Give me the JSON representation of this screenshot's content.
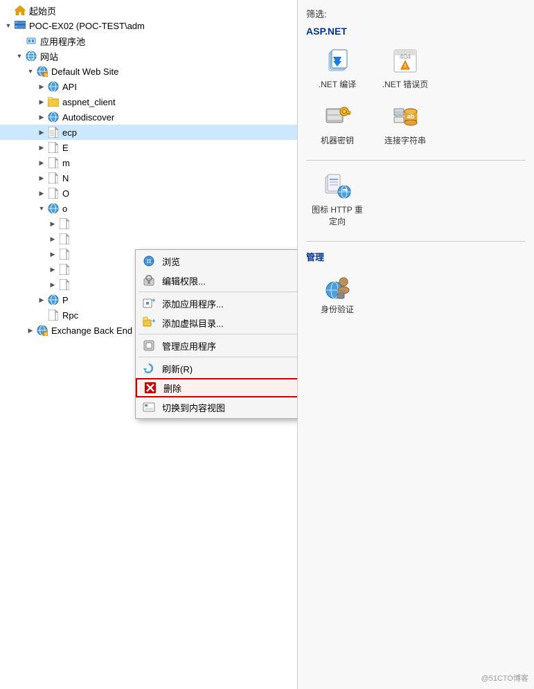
{
  "filter_label": "筛选:",
  "asp_net_section": "ASP.NET",
  "manage_section": "管理",
  "features": [
    {
      "id": "dotnet-compile",
      "label": ".NET 编译",
      "icon_type": "dotnet-compile"
    },
    {
      "id": "dotnet-error",
      "label": ".NET 错误页",
      "icon_type": "dotnet-error"
    },
    {
      "id": "machine-key",
      "label": "机器密钥",
      "icon_type": "machine-key"
    },
    {
      "id": "connection-string",
      "label": "连接字符串",
      "icon_type": "connection-string"
    },
    {
      "id": "mime-icon",
      "label": "图标 HTTP 重定向",
      "icon_type": "http-redirect"
    }
  ],
  "manage_features": [
    {
      "id": "auth",
      "label": "身份验证",
      "icon_type": "auth"
    }
  ],
  "tree": {
    "items": [
      {
        "id": "start-page",
        "label": "起始页",
        "indent": 0,
        "icon": "home",
        "expand": "none"
      },
      {
        "id": "server",
        "label": "POC-EX02 (POC-TEST\\adm",
        "indent": 0,
        "icon": "server",
        "expand": "down"
      },
      {
        "id": "app-pools",
        "label": "应用程序池",
        "indent": 1,
        "icon": "pool",
        "expand": "none"
      },
      {
        "id": "sites",
        "label": "网站",
        "indent": 1,
        "icon": "globe",
        "expand": "down"
      },
      {
        "id": "default-web-site",
        "label": "Default Web Site",
        "indent": 2,
        "icon": "globe-question",
        "expand": "down"
      },
      {
        "id": "api",
        "label": "API",
        "indent": 3,
        "icon": "globe",
        "expand": "right"
      },
      {
        "id": "aspnet-client",
        "label": "aspnet_client",
        "indent": 3,
        "icon": "folder",
        "expand": "right"
      },
      {
        "id": "autodiscover",
        "label": "Autodiscover",
        "indent": 3,
        "icon": "globe",
        "expand": "right"
      },
      {
        "id": "ecp",
        "label": "ecp",
        "indent": 3,
        "icon": "page",
        "expand": "right",
        "selected": true
      },
      {
        "id": "item-e",
        "label": "E",
        "indent": 3,
        "icon": "page",
        "expand": "right"
      },
      {
        "id": "item-m",
        "label": "m",
        "indent": 3,
        "icon": "page",
        "expand": "right"
      },
      {
        "id": "item-n",
        "label": "N",
        "indent": 3,
        "icon": "page",
        "expand": "right"
      },
      {
        "id": "item-o",
        "label": "O",
        "indent": 3,
        "icon": "page",
        "expand": "right"
      },
      {
        "id": "item-o2",
        "label": "o",
        "indent": 3,
        "icon": "globe",
        "expand": "down"
      },
      {
        "id": "item-o2-child1",
        "label": "",
        "indent": 4,
        "icon": "page",
        "expand": "right"
      },
      {
        "id": "item-o2-child2",
        "label": "",
        "indent": 4,
        "icon": "page",
        "expand": "right"
      },
      {
        "id": "item-o2-child3",
        "label": "",
        "indent": 4,
        "icon": "page",
        "expand": "right"
      },
      {
        "id": "item-o2-child4",
        "label": "",
        "indent": 4,
        "icon": "page",
        "expand": "right"
      },
      {
        "id": "item-o2-child5",
        "label": "",
        "indent": 4,
        "icon": "page",
        "expand": "right"
      },
      {
        "id": "item-p",
        "label": "P",
        "indent": 3,
        "icon": "globe",
        "expand": "right"
      },
      {
        "id": "rpc",
        "label": "Rpc",
        "indent": 3,
        "icon": "page",
        "expand": "none"
      },
      {
        "id": "exchange-backend",
        "label": "Exchange Back End",
        "indent": 2,
        "icon": "globe-question",
        "expand": "right"
      }
    ]
  },
  "context_menu": {
    "items": [
      {
        "id": "browse",
        "label": "浏览",
        "icon": "browse",
        "has_arrow": false
      },
      {
        "id": "edit-permissions",
        "label": "编辑权限...",
        "icon": "permissions",
        "has_arrow": false
      },
      {
        "id": "sep1",
        "type": "separator"
      },
      {
        "id": "add-app",
        "label": "添加应用程序...",
        "icon": "add-app",
        "has_arrow": false
      },
      {
        "id": "add-virtual",
        "label": "添加虚拟目录...",
        "icon": "add-virtual",
        "has_arrow": false
      },
      {
        "id": "sep2",
        "type": "separator"
      },
      {
        "id": "manage-app",
        "label": "管理应用程序",
        "icon": "manage-app",
        "has_arrow": true
      },
      {
        "id": "sep3",
        "type": "separator"
      },
      {
        "id": "refresh",
        "label": "刷新(R)",
        "icon": "refresh",
        "has_arrow": false
      },
      {
        "id": "delete",
        "label": "删除",
        "icon": "delete",
        "has_arrow": false,
        "highlighted": true
      },
      {
        "id": "switch-view",
        "label": "切换到内容视图",
        "icon": "switch-view",
        "has_arrow": false
      }
    ]
  },
  "watermark": "@51CTO博客"
}
